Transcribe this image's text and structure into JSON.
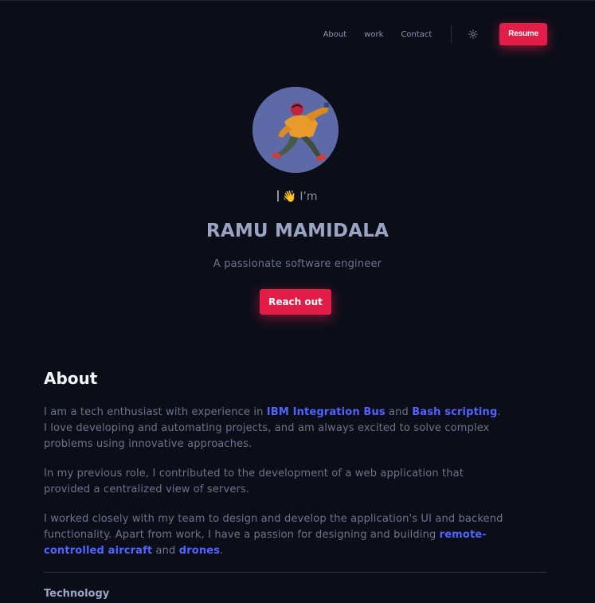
{
  "nav": {
    "links": [
      "About",
      "work",
      "Contact"
    ],
    "theme_icon": "sun-icon",
    "resume_label": "Resume"
  },
  "hero": {
    "greeting": "I’m",
    "greeting_emoji": "👋",
    "name": "RAMU MAMIDALA",
    "tagline": "A passionate software engineer",
    "cta_label": "Reach out"
  },
  "about": {
    "heading": "About",
    "p1": {
      "t1": "I am a tech enthusiast with experience in ",
      "link1": "IBM Integration Bus",
      "t2": " and ",
      "link2": "Bash scripting",
      "t3": ". I love developing and automating projects, and am always excited to solve complex problems using innovative approaches."
    },
    "p2": "In my previous role, I contributed to the development of a web application that provided a centralized view of servers.",
    "p3": {
      "t1": "I worked closely with my team to design and develop the application's UI and backend functionality. Apart from work, I have a passion for designing and building ",
      "link1": "remote-controlled aircraft",
      "t2": " and ",
      "link2": "drones",
      "t3": "."
    }
  },
  "technology": {
    "heading": "Technology"
  },
  "colors": {
    "background": "#0b0e19",
    "accent": "#e11d48",
    "link": "#5263ff",
    "muted_text": "#6c7489",
    "heading": "#9aa5c4"
  }
}
